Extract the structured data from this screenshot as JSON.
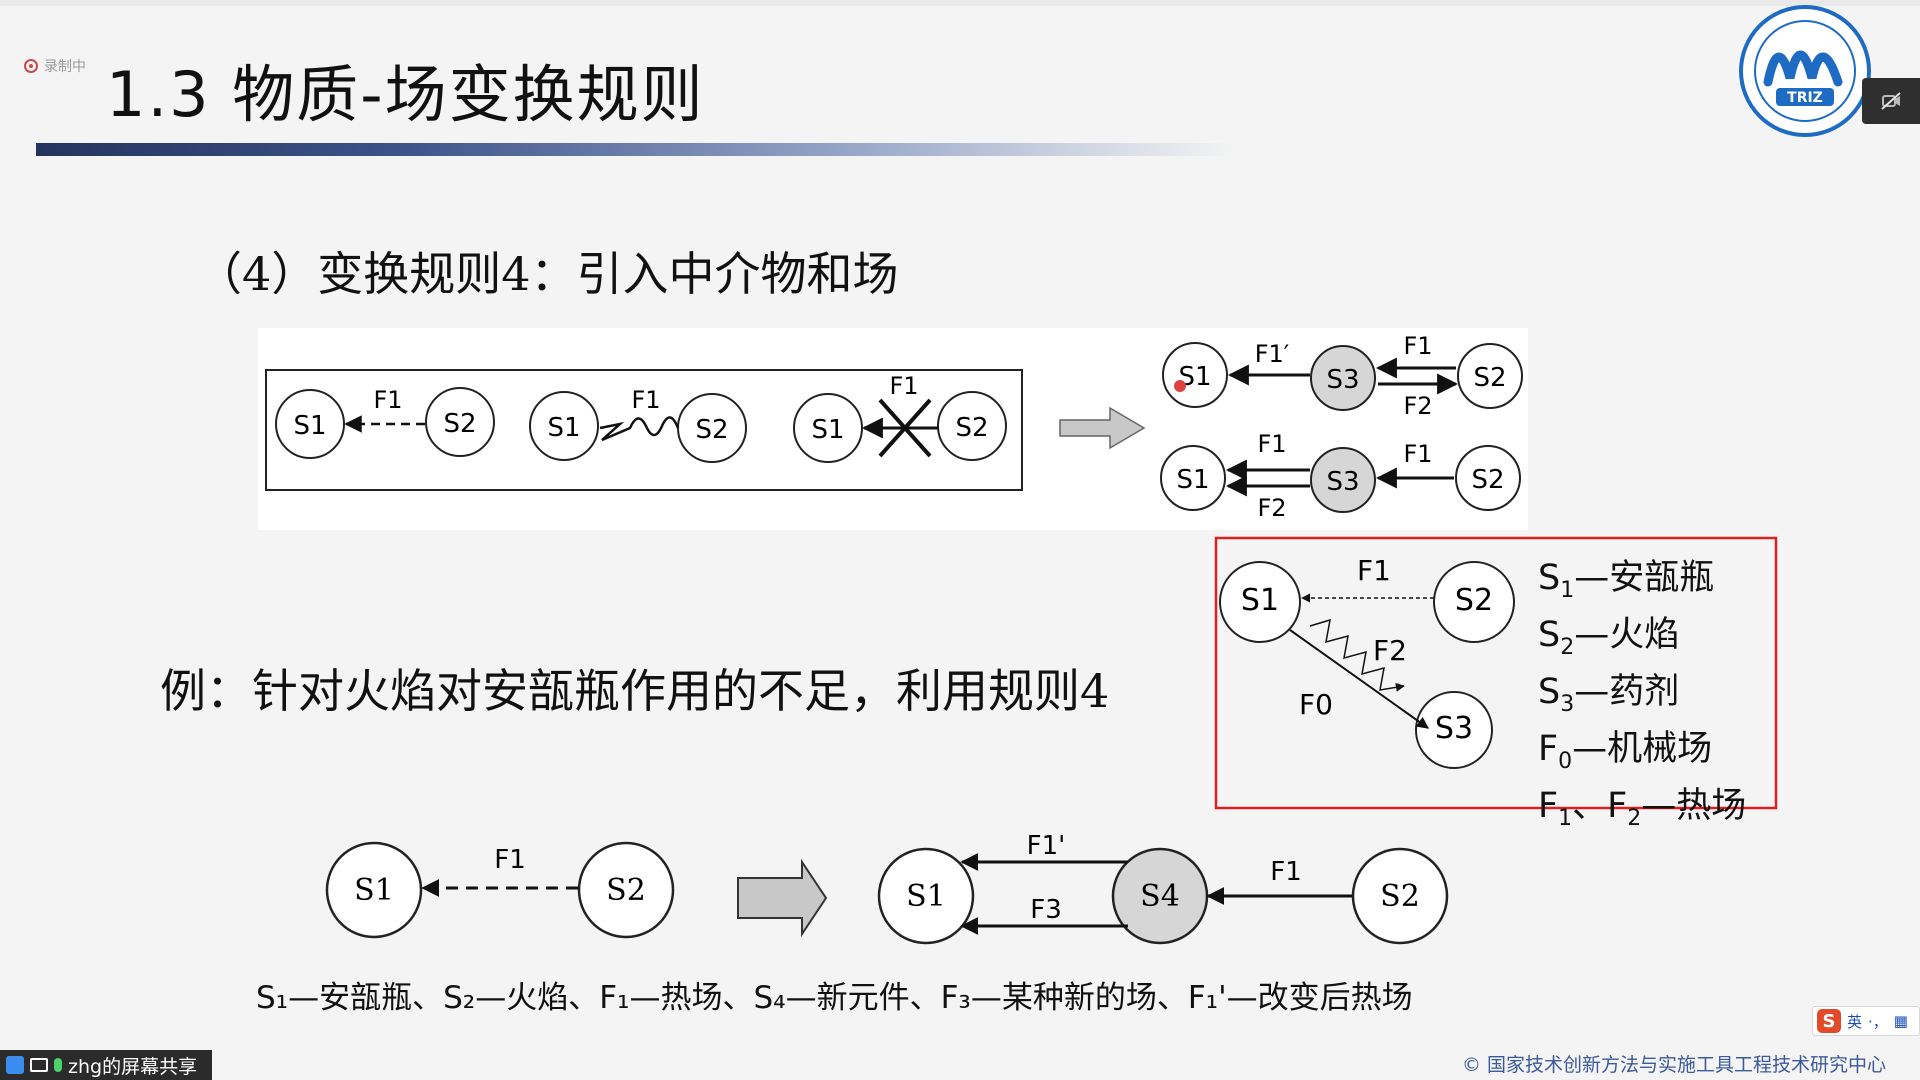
{
  "recording": {
    "label": "录制中",
    "icon": "recording-icon"
  },
  "title": "1.3 物质-场变换规则",
  "rule": "（4）变换规则4：引入中介物和场",
  "example": "例：针对火焰对安瓿瓶作用的不足，利用规则4",
  "figure1": {
    "left": {
      "nodes": [
        "S1",
        "S2",
        "S1",
        "S2",
        "S1",
        "S2"
      ],
      "fields": [
        "F1",
        "F1",
        "F1"
      ]
    },
    "right": {
      "top": {
        "nodes": [
          "S1",
          "S3",
          "S2"
        ],
        "fields": [
          "F1′",
          "F1",
          "F2"
        ]
      },
      "bottom": {
        "nodes": [
          "S1",
          "S3",
          "S2"
        ],
        "fields": [
          "F1",
          "F2",
          "F1"
        ]
      }
    }
  },
  "figure2": {
    "nodes": [
      "S1",
      "S2",
      "S3"
    ],
    "fields": [
      "F1",
      "F2",
      "F0"
    ]
  },
  "legend": [
    {
      "sym": "S",
      "sub": "1",
      "text": "—安瓿瓶"
    },
    {
      "sym": "S",
      "sub": "2",
      "text": "—火焰"
    },
    {
      "sym": "S",
      "sub": "3",
      "text": "—药剂"
    },
    {
      "sym": "F",
      "sub": "0",
      "text": "—机械场"
    },
    {
      "sym": "F",
      "sub": "1",
      "mid": "、F",
      "sub2": "2",
      "text": "—热场"
    }
  ],
  "figure3": {
    "nodes": [
      "S1",
      "S2",
      "S1",
      "S4",
      "S2"
    ],
    "fields": [
      "F1",
      "F1'",
      "F3",
      "F1"
    ]
  },
  "caption": "S₁—安瓿瓶、S₂—火焰、F₁—热场、S₄—新元件、F₃—某种新的场、F₁'—改变后热场",
  "share": {
    "label": "zhg的屏幕共享"
  },
  "ime": {
    "lang": "英",
    "punct": "·，",
    "logo": "S"
  },
  "copyright": "© 国家技术创新方法与实施工具工程技术研究中心",
  "colors": {
    "title_rule": "#24345e",
    "highlight_box": "#e02020",
    "copyright": "#3a5a9a",
    "logo": "#1e6bc4"
  },
  "logo_text": "TRIZ"
}
